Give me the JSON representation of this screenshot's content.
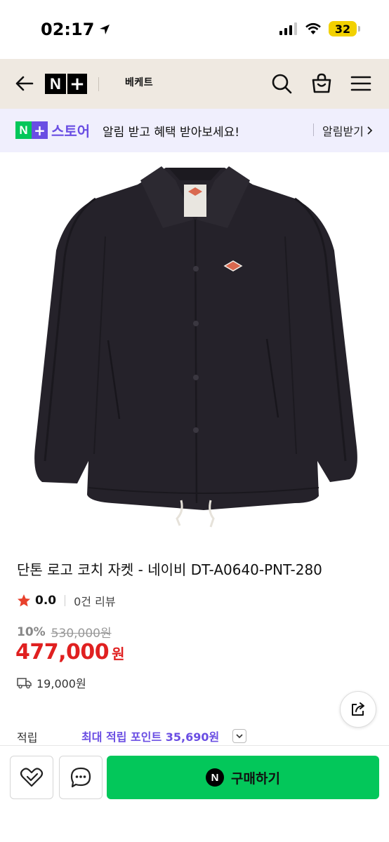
{
  "status_bar": {
    "time": "02:17",
    "battery": "32"
  },
  "nav": {
    "brand_n": "N",
    "brand_plus": "+",
    "store_name": "베케트"
  },
  "promo": {
    "logo_n": "N",
    "logo_plus": "+",
    "store_word": "스토어",
    "text": "알림 받고 혜택 받아보세요!",
    "alarm_label": "알림받기"
  },
  "product": {
    "image_icon": "jacket-image",
    "title": "단톤 로고 코치 자켓 - 네이비 DT-A0640-PNT-280",
    "rating": "0.0",
    "reviews": "0건 리뷰",
    "discount_pct": "10%",
    "original_price": "530,000원",
    "price": "477,000",
    "price_unit": "원",
    "shipping_fee": "19,000원",
    "points_label": "적립",
    "points_value": "최대 적립 포인트 35,690원"
  },
  "bottom": {
    "buy_n": "N",
    "buy_label": "구매하기"
  },
  "colors": {
    "naver_green": "#03c75a",
    "plus_purple": "#6a4ee3",
    "price_red": "#e02020",
    "nav_bg": "#efe9e1",
    "promo_bg": "#f0effd"
  }
}
